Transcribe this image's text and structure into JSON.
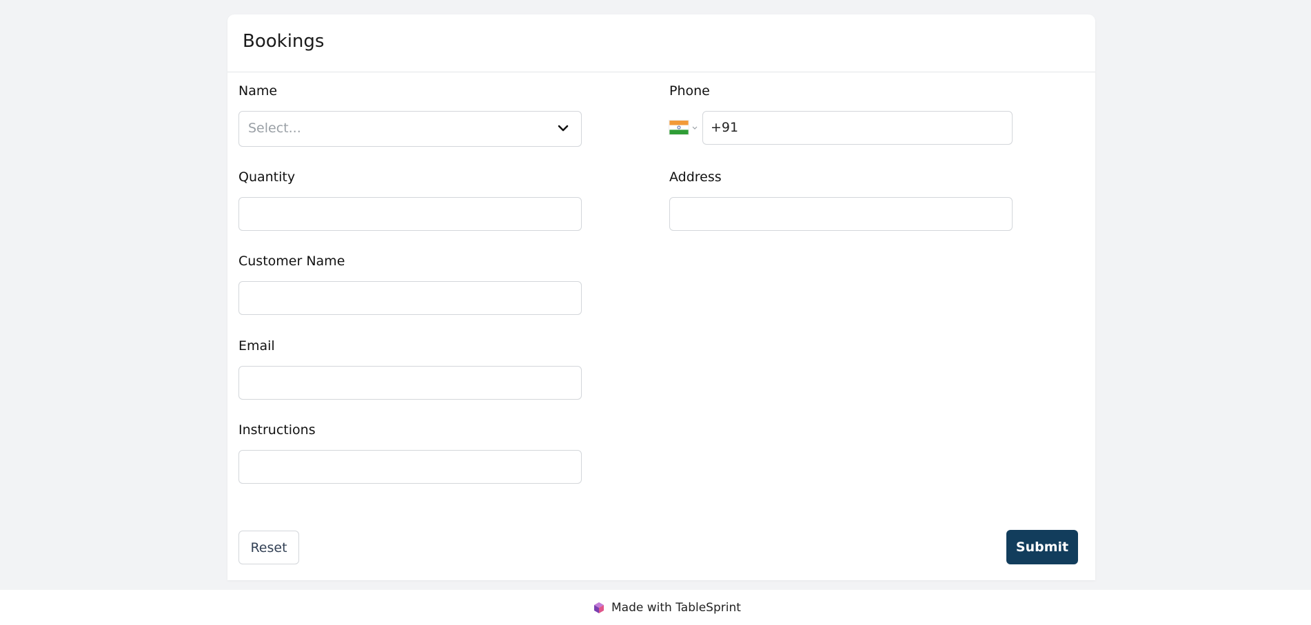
{
  "form": {
    "title": "Bookings",
    "fields": {
      "name": {
        "label": "Name",
        "placeholder": "Select..."
      },
      "phone": {
        "label": "Phone",
        "value": "+91",
        "country": "India"
      },
      "quantity": {
        "label": "Quantity",
        "value": ""
      },
      "address": {
        "label": "Address",
        "value": ""
      },
      "customer_name": {
        "label": "Customer Name",
        "value": ""
      },
      "email": {
        "label": "Email",
        "value": ""
      },
      "instructions": {
        "label": "Instructions",
        "value": ""
      }
    },
    "buttons": {
      "reset": "Reset",
      "submit": "Submit"
    }
  },
  "footer": {
    "text": "Made with TableSprint"
  },
  "colors": {
    "background": "#f2f3f5",
    "card": "#ffffff",
    "submit_button": "#123d5c",
    "border": "#d3d6da",
    "placeholder": "#9aa0a6"
  },
  "icons": {
    "name_dropdown": "chevron-down-icon",
    "country_flag": "india-flag-icon",
    "country_dropdown": "chevron-down-icon",
    "footer_logo": "tablesprint-logo-icon"
  }
}
